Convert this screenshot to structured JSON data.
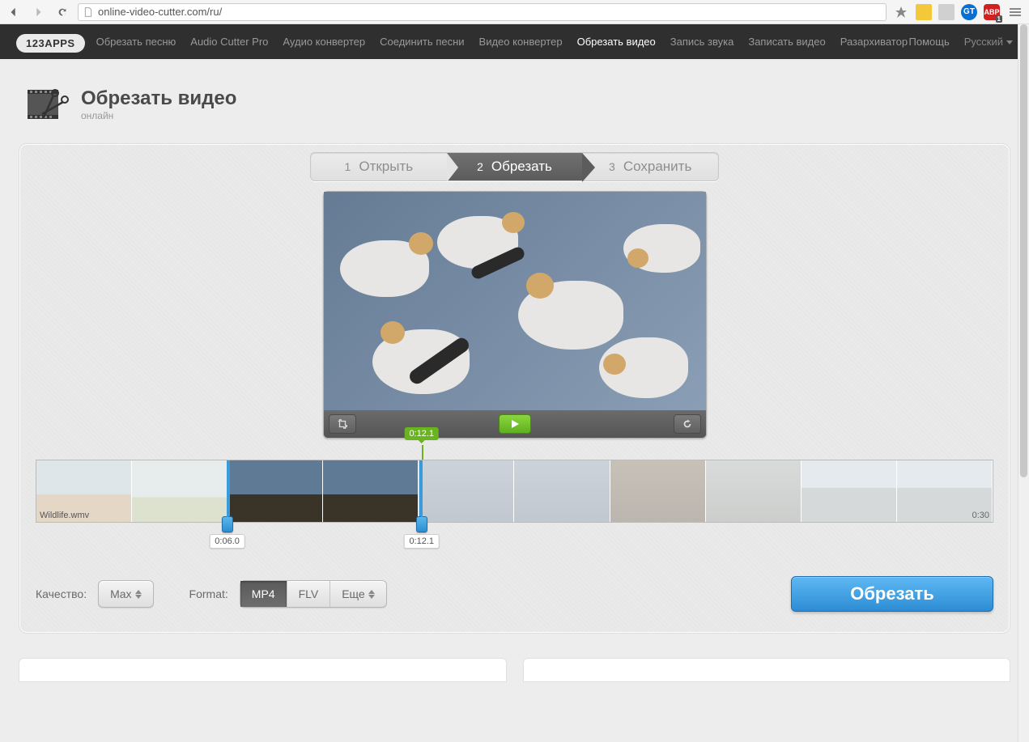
{
  "browser": {
    "url": "online-video-cutter.com/ru/"
  },
  "topbar": {
    "logo": "123APPS",
    "links": [
      "Обрезать песню",
      "Audio Cutter Pro",
      "Аудио конвертер",
      "Соединить песни",
      "Видео конвертер",
      "Обрезать видео",
      "Запись звука",
      "Записать видео",
      "Разархиватор"
    ],
    "active_index": 5,
    "help": "Помощь",
    "language": "Русский"
  },
  "header": {
    "title": "Обрезать видео",
    "subtitle": "онлайн"
  },
  "steps": {
    "items": [
      {
        "num": "1",
        "label": "Открыть"
      },
      {
        "num": "2",
        "label": "Обрезать"
      },
      {
        "num": "3",
        "label": "Сохранить"
      }
    ],
    "active": 1
  },
  "timeline": {
    "filename": "Wildlife.wmv",
    "duration": "0:30",
    "playhead": "0:12.1",
    "sel_start": "0:06.0",
    "sel_end": "0:12.1",
    "sel_start_pct": 20.0,
    "sel_end_pct": 40.3
  },
  "controls": {
    "quality_label": "Качество:",
    "quality_value": "Max",
    "format_label": "Format:",
    "formats": [
      "MP4",
      "FLV",
      "Еще"
    ],
    "format_active": 0,
    "cut_button": "Обрезать"
  }
}
